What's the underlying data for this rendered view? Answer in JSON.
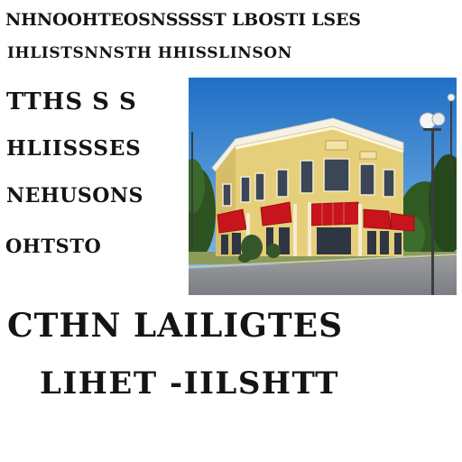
{
  "lines": {
    "line1": "NHNOOHTEOSNSSSST LBOSTI LSES",
    "line2": "IHLISTSNNSTH HHISSLINSON",
    "left1": "TTHS S S",
    "left2": "HLIISSSES",
    "left3": "NEHUSONS",
    "left4": "OHTSTO",
    "big1": "CTHN   LAILIGTES",
    "big2": "LIHET  -IILSHTT"
  },
  "photo": {
    "subject": "two-story-yellow-building-with-red-awnings",
    "colors": {
      "sky": "#2f7fcf",
      "facade": "#e6cf7a",
      "awning": "#c8141c",
      "roof": "#f4f1e6",
      "trees": "#2f5a23",
      "road": "#8a8c90"
    }
  }
}
